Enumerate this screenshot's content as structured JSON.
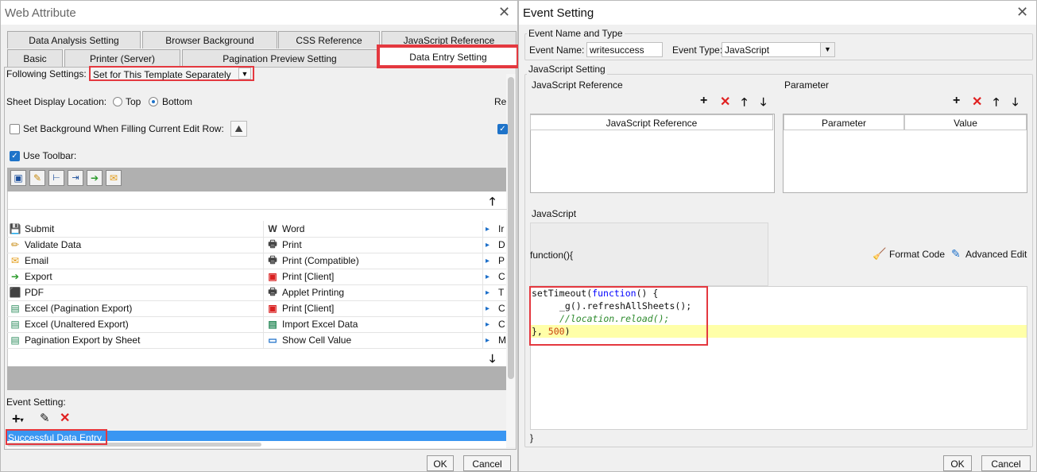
{
  "left": {
    "title": "Web Attribute",
    "tabs_row1": [
      "Data Analysis Setting",
      "Browser Background",
      "CSS Reference",
      "JavaScript Reference"
    ],
    "tabs_row2": [
      "Basic",
      "Printer (Server)",
      "Pagination Preview Setting",
      "Data Entry Setting"
    ],
    "following_label": "Following Settings:",
    "following_value": "Set for This Template Separately",
    "sheet_display_label": "Sheet Display Location:",
    "radio_top": "Top",
    "radio_bottom": "Bottom",
    "re_partial": "Re",
    "set_bg_label": "Set Background When Filling Current Edit Row:",
    "use_toolbar_label": "Use Toolbar:",
    "col1": [
      "Submit",
      "Validate Data",
      "Email",
      "Export",
      "PDF",
      "Excel (Pagination Export)",
      "Excel (Unaltered Export)",
      "Pagination Export by Sheet"
    ],
    "col2": [
      "Word",
      "Print",
      "Print (Compatible)",
      "Print [Client]",
      "Applet Printing",
      "Print [Client]",
      "Import Excel Data",
      "Show Cell Value"
    ],
    "col3": [
      "Ir",
      "D",
      "P",
      "C",
      "T",
      "C",
      "C",
      "M"
    ],
    "event_setting_label": "Event Setting:",
    "event_item": "Successful Data Entry",
    "ok": "OK",
    "cancel": "Cancel"
  },
  "right": {
    "title": "Event Setting",
    "name_type_group": "Event Name and Type",
    "event_name_label": "Event Name:",
    "event_name_value": "writesuccess",
    "event_type_label": "Event Type:",
    "event_type_value": "JavaScript",
    "js_setting_group": "JavaScript Setting",
    "js_ref_group": "JavaScript Reference",
    "js_ref_header": "JavaScript Reference",
    "param_group": "Parameter",
    "param_header": "Parameter",
    "value_header": "Value",
    "javascript_label": "JavaScript",
    "function_open": "function(){",
    "format_code": "Format Code",
    "advanced_edit": "Advanced Edit",
    "code_line1_a": "setTimeout(",
    "code_line1_b": "function",
    "code_line1_c": "() {",
    "code_line2": "_g().refreshAllSheets();",
    "code_line3": "//location.reload();",
    "code_line4_a": "}, ",
    "code_line4_b": "500",
    "code_line4_c": ")",
    "closing_brace": "}",
    "ok": "OK",
    "cancel": "Cancel"
  },
  "colors": {
    "accent": "#1e73c9",
    "highlight": "#e4383f",
    "selected_row": "#3a96f2",
    "code_highlight": "#ffffa8",
    "keyword": "#0000ff",
    "comment": "#2e8b2e"
  }
}
